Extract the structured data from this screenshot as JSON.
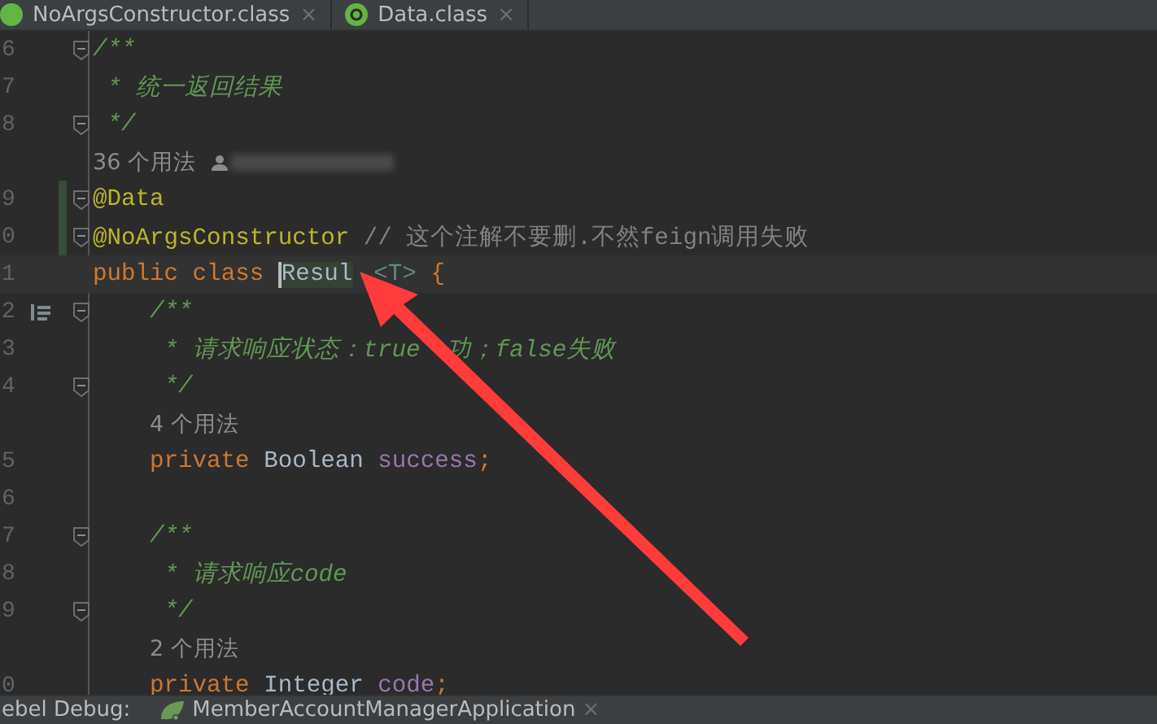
{
  "tabs": [
    {
      "label": "NoArgsConstructor.class",
      "selected": false
    },
    {
      "label": "Data.class",
      "selected": false
    }
  ],
  "close_glyph": "×",
  "lines": [
    {
      "kind": "code",
      "number": "6",
      "fold": true,
      "changed": false,
      "current": false,
      "impl": false,
      "tokens": [
        {
          "kind": "doc",
          "text": "/**"
        }
      ]
    },
    {
      "kind": "code",
      "number": "7",
      "fold": false,
      "changed": false,
      "current": false,
      "impl": false,
      "tokens": [
        {
          "kind": "doc",
          "text": " * 统一返回结果"
        }
      ]
    },
    {
      "kind": "code",
      "number": "8",
      "fold": true,
      "changed": false,
      "current": false,
      "impl": false,
      "tokens": [
        {
          "kind": "doc",
          "text": " */"
        }
      ]
    },
    {
      "kind": "usage",
      "text": "36 个用法",
      "author": true
    },
    {
      "kind": "code",
      "number": "9",
      "fold": true,
      "changed": true,
      "current": false,
      "impl": false,
      "tokens": [
        {
          "kind": "annotation",
          "text": "@Data"
        }
      ]
    },
    {
      "kind": "code",
      "number": "0",
      "fold": true,
      "changed": true,
      "current": false,
      "impl": false,
      "tokens": [
        {
          "kind": "annotation",
          "text": "@NoArgsConstructor"
        },
        {
          "kind": "comment",
          "text": " // 这个注解不要删.不然feign调用失败"
        }
      ]
    },
    {
      "kind": "code",
      "number": "1",
      "fold": false,
      "changed": false,
      "current": true,
      "impl": false,
      "tokens": [
        {
          "kind": "keyword",
          "text": "public class "
        },
        {
          "kind": "highlight",
          "text": "Resul"
        },
        {
          "kind": "typeparam",
          "text": "<T>"
        },
        {
          "kind": "keyword",
          "text": " {"
        }
      ],
      "children": [
        {
          "kind": "code",
          "number": "2",
          "fold": true,
          "changed": false,
          "current": false,
          "impl": true,
          "tokens": [
            {
              "kind": "doc",
              "text": "/**"
            }
          ]
        },
        {
          "kind": "code",
          "number": "3",
          "fold": false,
          "changed": false,
          "current": false,
          "impl": false,
          "tokens": [
            {
              "kind": "doc",
              "text": " * 请求响应状态：true"
            },
            {
              "kind": "doc-after-gap",
              "text": "功；false失败"
            }
          ]
        },
        {
          "kind": "code",
          "number": "4",
          "fold": true,
          "changed": false,
          "current": false,
          "impl": false,
          "tokens": [
            {
              "kind": "doc",
              "text": " */"
            }
          ]
        },
        {
          "kind": "usage",
          "text": "4 个用法",
          "author": false
        },
        {
          "kind": "code",
          "number": "5",
          "fold": false,
          "changed": false,
          "current": false,
          "impl": false,
          "tokens": [
            {
              "kind": "keyword",
              "text": "private "
            },
            {
              "kind": "plain",
              "text": "Boolean "
            },
            {
              "kind": "field",
              "text": "success"
            },
            {
              "kind": "keyword",
              "text": ";"
            }
          ]
        },
        {
          "kind": "code",
          "number": "6",
          "fold": false,
          "changed": false,
          "current": false,
          "impl": false
        },
        {
          "kind": "code",
          "number": "7",
          "fold": true,
          "changed": false,
          "current": false,
          "impl": false,
          "tokens": [
            {
              "kind": "doc",
              "text": "/**"
            }
          ]
        },
        {
          "kind": "code",
          "number": "8",
          "fold": false,
          "changed": false,
          "current": false,
          "impl": false,
          "tokens": [
            {
              "kind": "doc",
              "text": " * 请求响应code"
            }
          ]
        },
        {
          "kind": "code",
          "number": "9",
          "fold": true,
          "changed": false,
          "current": false,
          "impl": false,
          "tokens": [
            {
              "kind": "doc",
              "text": " */"
            }
          ]
        },
        {
          "kind": "usage",
          "text": "2 个用法",
          "author": false
        },
        {
          "kind": "code",
          "number": "0",
          "fold": false,
          "changed": false,
          "current": false,
          "impl": false,
          "tokens": [
            {
              "kind": "keyword",
              "text": "private "
            },
            {
              "kind": "plain",
              "text": "Integer "
            },
            {
              "kind": "field",
              "text": "code"
            },
            {
              "kind": "keyword",
              "text": ";"
            }
          ]
        }
      ]
    }
  ],
  "status_bar": {
    "label": "ebel Debug:",
    "app": "MemberAccountManagerApplication"
  }
}
